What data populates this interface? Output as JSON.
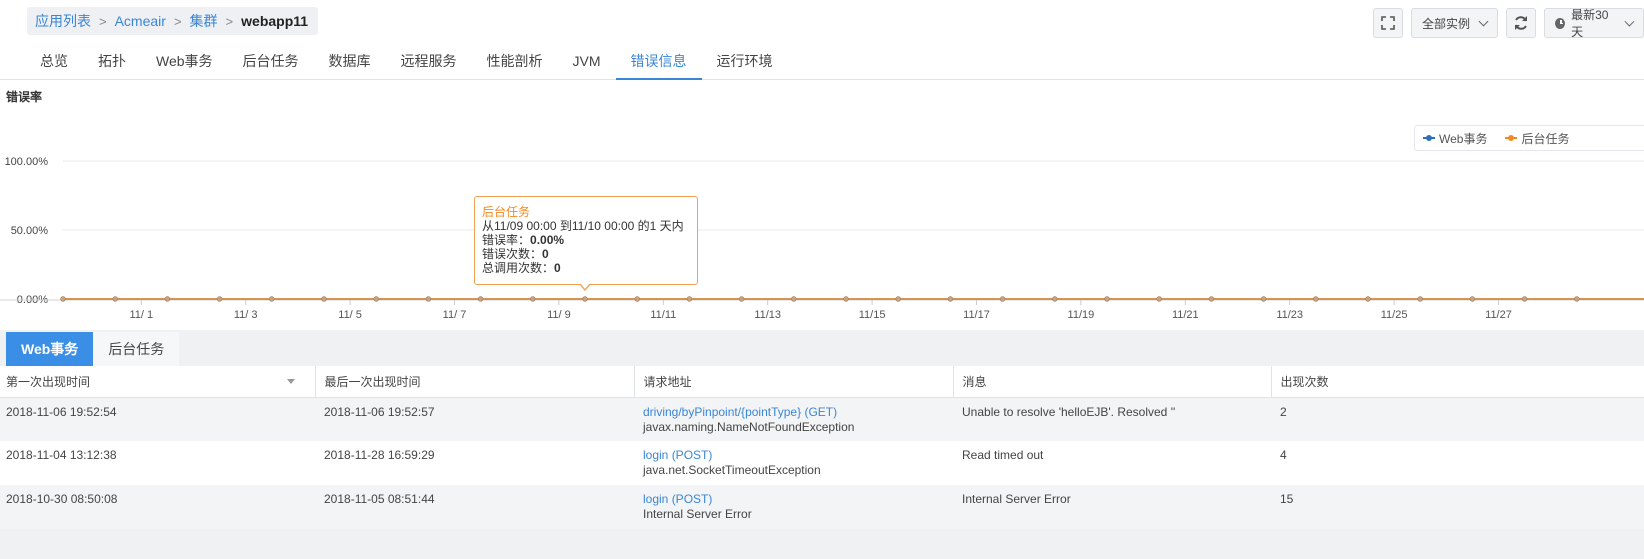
{
  "breadcrumb": {
    "items": [
      "应用列表",
      "Acmeair",
      "集群"
    ],
    "current": "webapp11"
  },
  "controls": {
    "fullscreen_icon": "fullscreen-icon",
    "instances_label": "全部实例",
    "refresh_icon": "refresh-icon",
    "time_range_label": "最新30天"
  },
  "tabs": [
    "总览",
    "拓扑",
    "Web事务",
    "后台任务",
    "数据库",
    "远程服务",
    "性能剖析",
    "JVM",
    "错误信息",
    "运行环境"
  ],
  "active_tab": "错误信息",
  "chart_data": {
    "type": "line",
    "title": "错误率",
    "xlabel": "",
    "ylabel": "",
    "y_ticks": [
      "0.00%",
      "50.00%",
      "100.00%"
    ],
    "ylim": [
      0,
      100
    ],
    "x_tick_labels": [
      "11/ 1",
      "11/ 3",
      "11/ 5",
      "11/ 7",
      "11/ 9",
      "11/11",
      "11/13",
      "11/15",
      "11/17",
      "11/19",
      "11/21",
      "11/23",
      "11/25",
      "11/27"
    ],
    "legend_position": "top-right",
    "series": [
      {
        "name": "Web事务",
        "color": "#2f6fb5",
        "values": [
          0,
          0,
          0,
          0,
          0,
          0,
          0,
          0,
          0,
          0,
          0,
          0,
          0,
          0,
          0,
          0,
          0,
          0,
          0,
          0,
          0,
          0,
          0,
          0,
          0,
          0,
          0,
          0,
          0,
          0
        ]
      },
      {
        "name": "后台任务",
        "color": "#f08a24",
        "values": [
          0,
          0,
          0,
          0,
          0,
          0,
          0,
          0,
          0,
          0,
          0,
          0,
          0,
          0,
          0,
          0,
          0,
          0,
          0,
          0,
          0,
          0,
          0,
          0,
          0,
          0,
          0,
          0,
          0,
          0
        ]
      }
    ]
  },
  "tooltip": {
    "title": "后台任务",
    "range": " 从11/09 00:00 到11/10 00:00 的1 天内",
    "rate_label": "错误率：",
    "rate_value": "0.00%",
    "count_label": "错误次数：",
    "count_value": "0",
    "calls_label": "总调用次数：",
    "calls_value": "0"
  },
  "subtabs": [
    "Web事务",
    "后台任务"
  ],
  "table": {
    "headers": [
      "第一次出现时间",
      "最后一次出现时间",
      "请求地址",
      "消息",
      "出现次数"
    ],
    "rows": [
      {
        "first": "2018-11-06 19:52:54",
        "last": "2018-11-06 19:52:57",
        "url": "driving/byPinpoint/{pointType} (GET)",
        "exception": "javax.naming.NameNotFoundException",
        "message": "Unable to resolve 'helloEJB'. Resolved ''",
        "count": "2"
      },
      {
        "first": "2018-11-04 13:12:38",
        "last": "2018-11-28 16:59:29",
        "url": "login (POST)",
        "exception": "java.net.SocketTimeoutException",
        "message": "Read timed out",
        "count": "4"
      },
      {
        "first": "2018-10-30 08:50:08",
        "last": "2018-11-05 08:51:44",
        "url": "login (POST)",
        "exception": "Internal Server Error",
        "message": "Internal Server Error",
        "count": "15"
      }
    ]
  }
}
